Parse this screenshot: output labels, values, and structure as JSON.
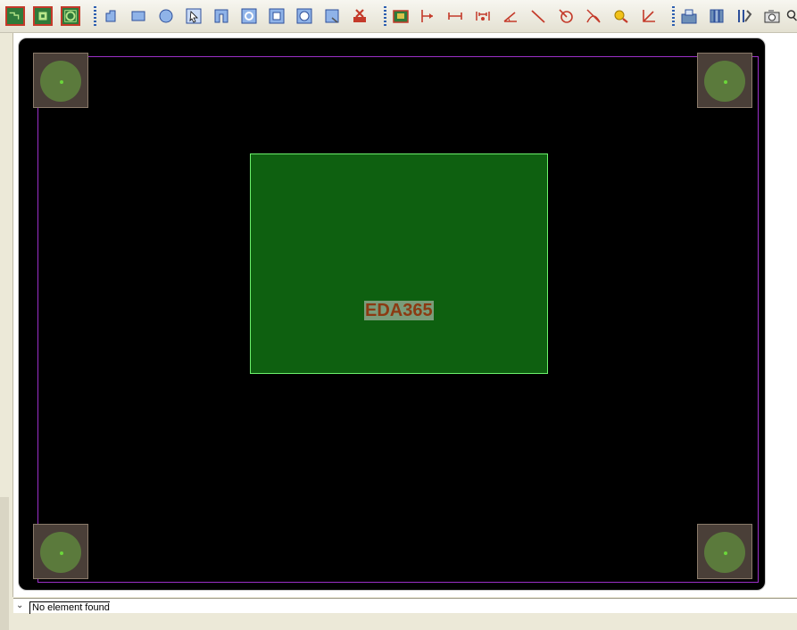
{
  "toolbar": {
    "groups": [
      [
        "board-view-icon",
        "board-top-icon",
        "board-bottom-icon"
      ],
      [
        "line-tool-icon",
        "rectangle-tool-icon",
        "circle-tool-icon",
        "select-tool-icon",
        "polygon-tool-icon",
        "arc-tool-icon",
        "square-tool-icon",
        "round-tool-icon",
        "fill-tool-icon",
        "delete-tool-icon"
      ],
      [
        "measure-board-icon",
        "dimension-tool-icon",
        "distance-tool-icon",
        "gap-tool-icon",
        "angle-tool-icon",
        "line-measure-icon",
        "radius-tool-icon",
        "curve-tool-icon",
        "zoom-search-icon",
        "axis-tool-icon"
      ],
      [
        "odb-export-icon",
        "library-icon",
        "parameters-icon",
        "camera-icon",
        "more-icon"
      ]
    ]
  },
  "canvas": {
    "component_label": "EDA365",
    "colors": {
      "background": "#000000",
      "board_edge": "#9b30c8",
      "component": "#0e6010",
      "component_border": "#6cf26c",
      "pad": "#4a3f38",
      "pad_ring": "#5b7a3c"
    }
  },
  "statusbar": {
    "message": "No element found"
  }
}
